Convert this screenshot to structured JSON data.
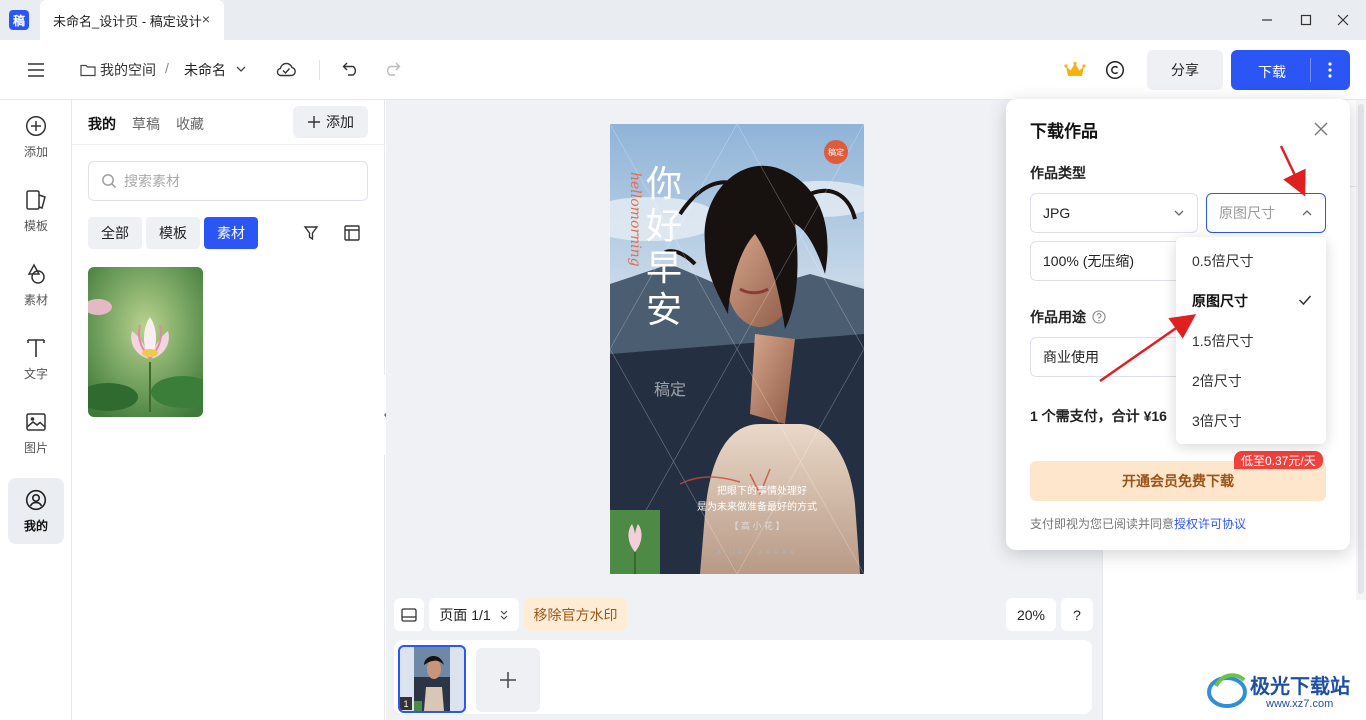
{
  "titlebar": {
    "logo_char": "稿",
    "tab_title": "未命名_设计页 - 稿定设计",
    "tab_close": "×"
  },
  "toolbar": {
    "space_label": "我的空间",
    "separator": "/",
    "doc_name": "未命名",
    "share_label": "分享",
    "download_label": "下载"
  },
  "rail": {
    "items": [
      {
        "label": "添加",
        "icon": "plus-circle-icon"
      },
      {
        "label": "模板",
        "icon": "template-icon"
      },
      {
        "label": "素材",
        "icon": "shapes-icon"
      },
      {
        "label": "文字",
        "icon": "text-icon"
      },
      {
        "label": "图片",
        "icon": "image-icon"
      },
      {
        "label": "我的",
        "icon": "user-icon"
      }
    ]
  },
  "panel": {
    "tabs": [
      "我的",
      "草稿",
      "收藏"
    ],
    "add_label": "添加",
    "search_placeholder": "搜索素材",
    "chips": [
      "全部",
      "模板",
      "素材"
    ]
  },
  "poster": {
    "badge": "稿定",
    "title_chars": [
      "你",
      "好",
      "早",
      "安"
    ],
    "script_text": "hellomorning",
    "watermark": "稿定",
    "line1": "把眼下的事情处理好",
    "line2": "是为未来做准备最好的方式",
    "author": "【 高 小 花 】",
    "bottom_text": "XIUAO   XADAN"
  },
  "canvas_controls": {
    "page_label": "页面 1/1",
    "watermark_label": "移除官方水印",
    "zoom": "20%",
    "help": "?",
    "page_number": "1"
  },
  "modal": {
    "title": "下载作品",
    "type_label": "作品类型",
    "format_value": "JPG",
    "size_value": "原图尺寸",
    "quality_value": "100% (无压缩)",
    "usage_label": "作品用途",
    "usage_value": "商业使用",
    "price_line": "1 个需支付，合计 ¥16",
    "member_button": "开通会员免费下载",
    "member_badge": "低至0.37元/天",
    "agree_text": "支付即视为您已阅读并同意",
    "agree_link": "授权许可协议"
  },
  "size_dropdown": {
    "options": [
      "0.5倍尺寸",
      "原图尺寸",
      "1.5倍尺寸",
      "2倍尺寸",
      "3倍尺寸"
    ],
    "selected": "原图尺寸"
  },
  "site_watermark": {
    "name": "极光下载站",
    "url": "www.xz7.com"
  },
  "colors": {
    "accent": "#2b56f5",
    "annotation_arrow": "#e02020"
  }
}
